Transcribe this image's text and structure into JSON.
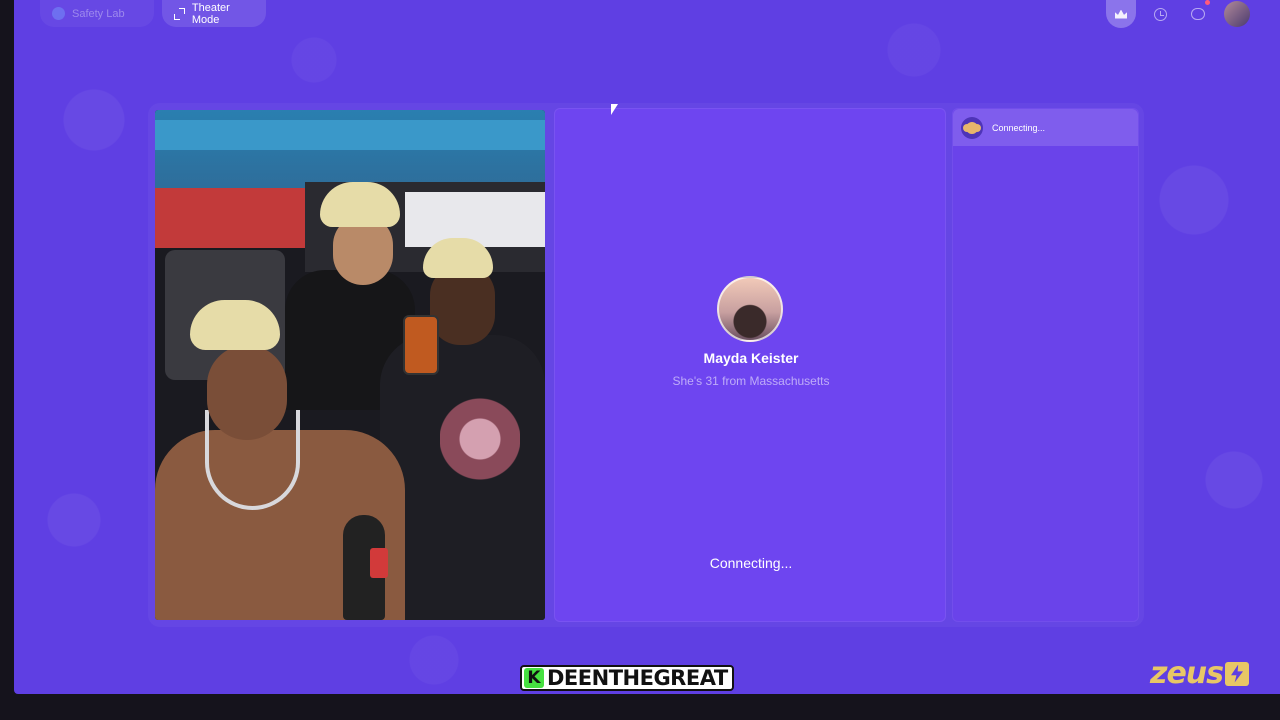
{
  "topbar": {
    "safety_lab_label": "Safety Lab",
    "theater_mode_label": "Theater Mode"
  },
  "call": {
    "name": "Mayda Keister",
    "subtitle": "She's 31 from Massachusetts",
    "status": "Connecting..."
  },
  "side_panel": {
    "status": "Connecting..."
  },
  "overlay": {
    "streamer_badge_letter": "K",
    "streamer_name": "DEENTHEGREAT",
    "brand_logo_text": "zeus"
  },
  "colors": {
    "app_background": "#5f3fe3",
    "panel": "#6e45f0",
    "badge_green": "#46e040",
    "brand_gold": "#e8c766"
  },
  "icons": [
    "shield-icon",
    "expand-icon",
    "crown-icon",
    "history-icon",
    "chat-icon",
    "avatar",
    "monkey-icon",
    "cursor",
    "zeus-bolt-icon"
  ]
}
